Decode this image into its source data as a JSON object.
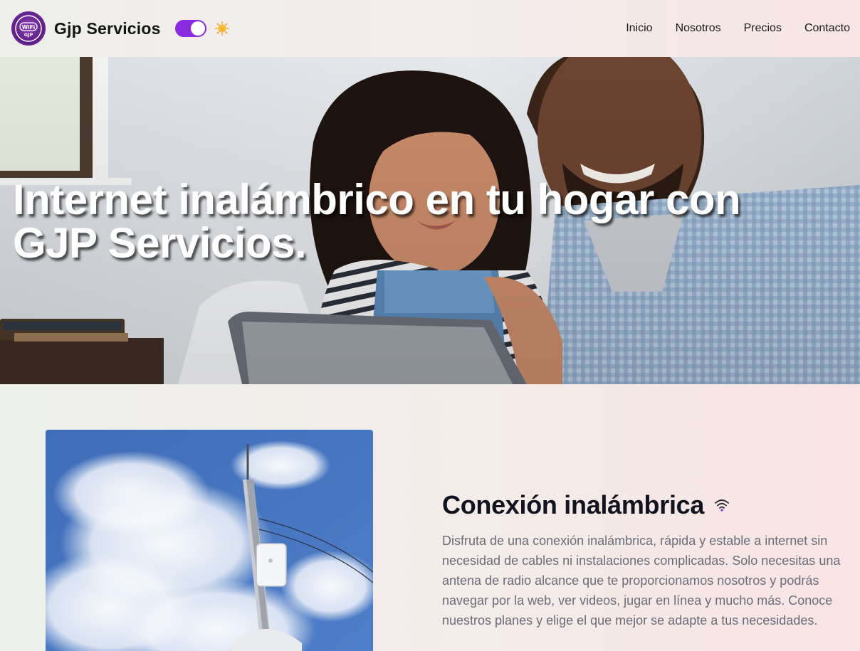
{
  "brand": {
    "name": "Gjp Servicios",
    "logo_text_top": "WiFi",
    "logo_text_bottom": "GJP"
  },
  "theme_toggle": {
    "state": "on",
    "icon": "sun-icon"
  },
  "nav": {
    "items": [
      {
        "label": "Inicio"
      },
      {
        "label": "Nosotros"
      },
      {
        "label": "Precios"
      },
      {
        "label": "Contacto"
      }
    ]
  },
  "hero": {
    "title": "Internet inalámbrico en tu hogar con GJP Servicios."
  },
  "connection": {
    "title": "Conexión inalámbrica",
    "icon": "wifi-icon",
    "text": "Disfruta de una conexión inalámbrica, rápida y estable a internet sin necesidad de cables ni instalaciones complicadas. Solo necesitas una antena de radio alcance que te proporcionamos nosotros y podrás navegar por la web, ver videos, jugar en línea y mucho más. Conoce nuestros planes y elige el que mejor se adapte a tus necesidades."
  },
  "colors": {
    "accent": "#8a2be2",
    "logo_purple": "#5d1f86",
    "heading": "#111320",
    "body_text": "#6c6c78"
  }
}
